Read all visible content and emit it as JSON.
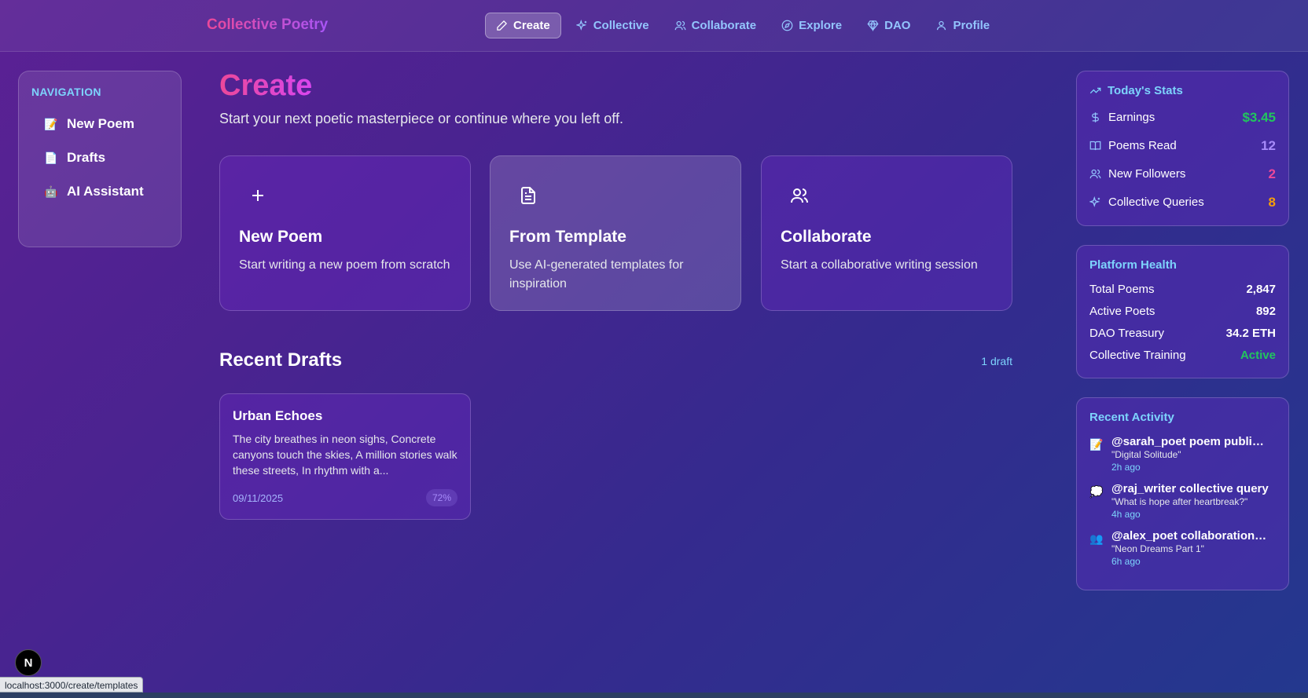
{
  "brand": "Collective Poetry",
  "nav": [
    {
      "label": "Create",
      "icon": "pencil-icon",
      "active": true
    },
    {
      "label": "Collective",
      "icon": "sparkles-icon"
    },
    {
      "label": "Collaborate",
      "icon": "users-icon"
    },
    {
      "label": "Explore",
      "icon": "compass-icon"
    },
    {
      "label": "DAO",
      "icon": "diamond-icon"
    },
    {
      "label": "Profile",
      "icon": "user-icon"
    }
  ],
  "sidebar": {
    "title": "NAVIGATION",
    "items": [
      {
        "emoji": "📝",
        "label": "New Poem"
      },
      {
        "emoji": "📄",
        "label": "Drafts"
      },
      {
        "emoji": "🤖",
        "label": "AI Assistant"
      }
    ]
  },
  "main": {
    "title": "Create",
    "subtitle": "Start your next poetic masterpiece or continue where you left off.",
    "cards": [
      {
        "title": "New Poem",
        "desc": "Start writing a new poem from scratch",
        "icon": "plus-icon"
      },
      {
        "title": "From Template",
        "desc": "Use AI-generated templates for inspiration",
        "icon": "document-icon"
      },
      {
        "title": "Collaborate",
        "desc": "Start a collaborative writing session",
        "icon": "users-icon"
      }
    ],
    "drafts_title": "Recent Drafts",
    "drafts_count": "1 draft",
    "draft": {
      "title": "Urban Echoes",
      "excerpt": "The city breathes in neon sighs, Concrete canyons touch the skies, A million stories walk these streets, In rhythm with a...",
      "date": "09/11/2025",
      "progress": "72%"
    }
  },
  "stats": {
    "title": "Today's Stats",
    "rows": [
      {
        "label": "Earnings",
        "value": "$3.45",
        "color": "#22c55e",
        "icon": "dollar-icon"
      },
      {
        "label": "Poems Read",
        "value": "12",
        "color": "#a78bfa",
        "icon": "book-icon"
      },
      {
        "label": "New Followers",
        "value": "2",
        "color": "#ec4899",
        "icon": "users-icon"
      },
      {
        "label": "Collective Queries",
        "value": "8",
        "color": "#f59e0b",
        "icon": "sparkles-icon"
      }
    ]
  },
  "health": {
    "title": "Platform Health",
    "rows": [
      {
        "label": "Total Poems",
        "value": "2,847",
        "color": "#ffffff"
      },
      {
        "label": "Active Poets",
        "value": "892",
        "color": "#ffffff"
      },
      {
        "label": "DAO Treasury",
        "value": "34.2 ETH",
        "color": "#ffffff"
      },
      {
        "label": "Collective Training",
        "value": "Active",
        "color": "#22c55e"
      }
    ]
  },
  "activity": {
    "title": "Recent Activity",
    "items": [
      {
        "emoji": "📝",
        "main": "@sarah_poet poem published",
        "sub": "\"Digital Solitude\"",
        "time": "2h ago"
      },
      {
        "emoji": "💭",
        "main": "@raj_writer collective query",
        "sub": "\"What is hope after heartbreak?\"",
        "time": "4h ago"
      },
      {
        "emoji": "👥",
        "main": "@alex_poet collaboration st...",
        "sub": "\"Neon Dreams Part 1\"",
        "time": "6h ago"
      }
    ]
  },
  "status_url": "localhost:3000/create/templates",
  "next_badge": "N"
}
